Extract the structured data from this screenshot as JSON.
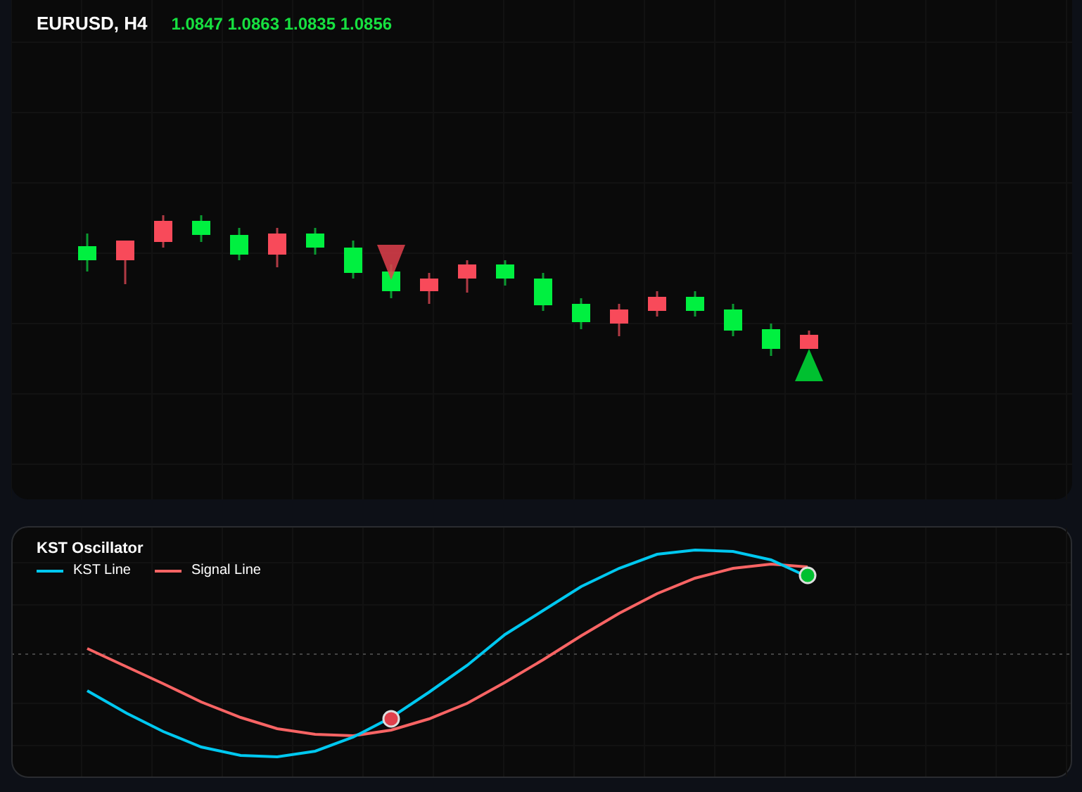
{
  "price_chart": {
    "symbol": "EURUSD, H4",
    "ohlc": "1.0847 1.0863 1.0835 1.0856"
  },
  "oscillator": {
    "title": "KST Oscillator",
    "legend": [
      {
        "label": "KST Line",
        "color": "#00c8f0"
      },
      {
        "label": "Signal Line",
        "color": "#f86464"
      }
    ]
  }
}
